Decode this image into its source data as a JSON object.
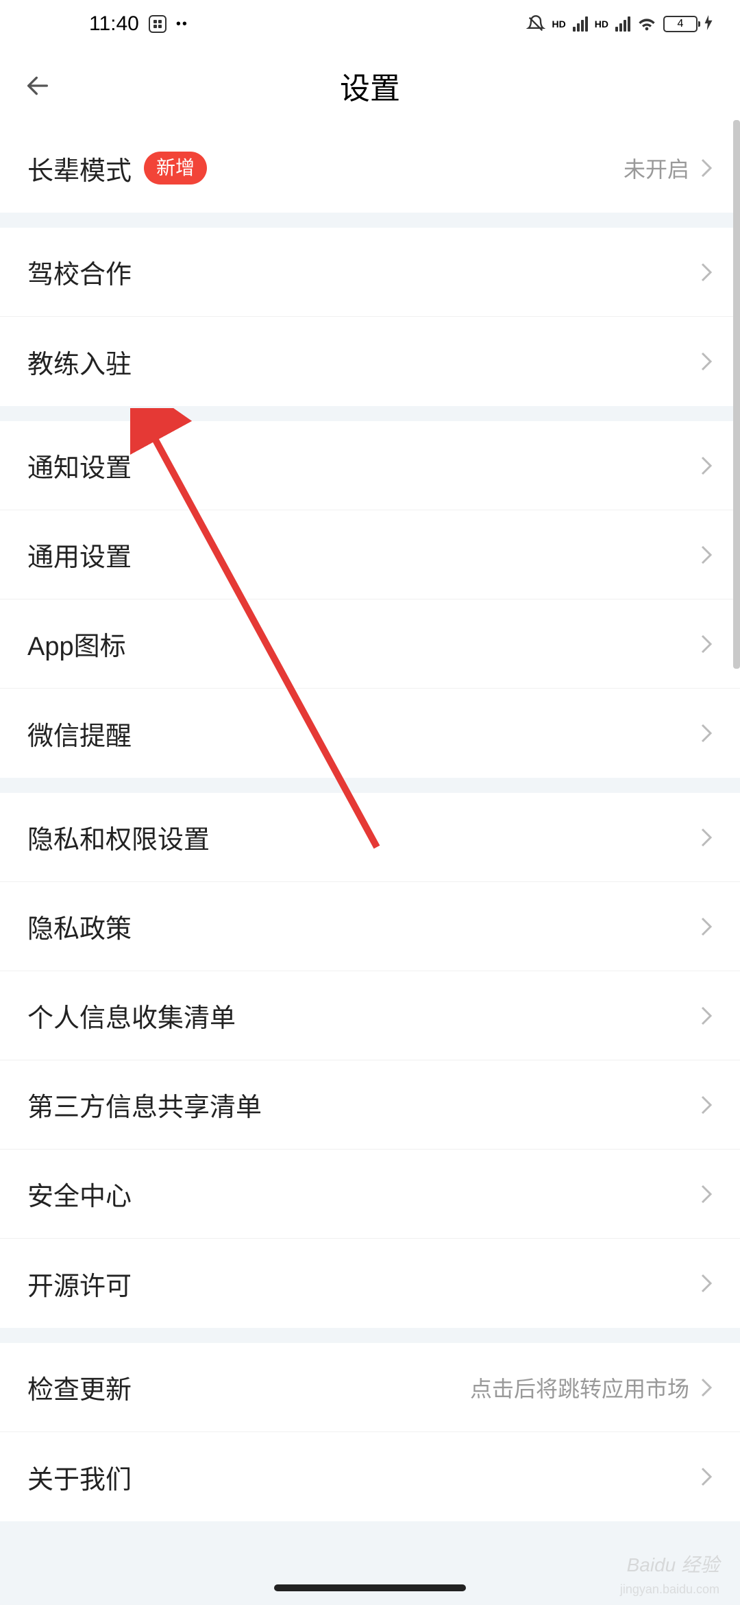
{
  "status_bar": {
    "time": "11:40",
    "battery_level": "4"
  },
  "header": {
    "title": "设置"
  },
  "sections": [
    {
      "rows": [
        {
          "label": "长辈模式",
          "badge": "新增",
          "value": "未开启"
        }
      ]
    },
    {
      "rows": [
        {
          "label": "驾校合作"
        },
        {
          "label": "教练入驻"
        }
      ]
    },
    {
      "rows": [
        {
          "label": "通知设置"
        },
        {
          "label": "通用设置"
        },
        {
          "label": "App图标"
        },
        {
          "label": "微信提醒"
        }
      ]
    },
    {
      "rows": [
        {
          "label": "隐私和权限设置"
        },
        {
          "label": "隐私政策"
        },
        {
          "label": "个人信息收集清单"
        },
        {
          "label": "第三方信息共享清单"
        },
        {
          "label": "安全中心"
        },
        {
          "label": "开源许可"
        }
      ]
    },
    {
      "rows": [
        {
          "label": "检查更新",
          "value": "点击后将跳转应用市场"
        },
        {
          "label": "关于我们"
        }
      ]
    }
  ],
  "watermark": {
    "main": "Baidu 经验",
    "sub": "jingyan.baidu.com"
  },
  "colors": {
    "accent": "#f24438",
    "bg": "#f1f5f8",
    "text": "#222",
    "muted": "#999"
  }
}
